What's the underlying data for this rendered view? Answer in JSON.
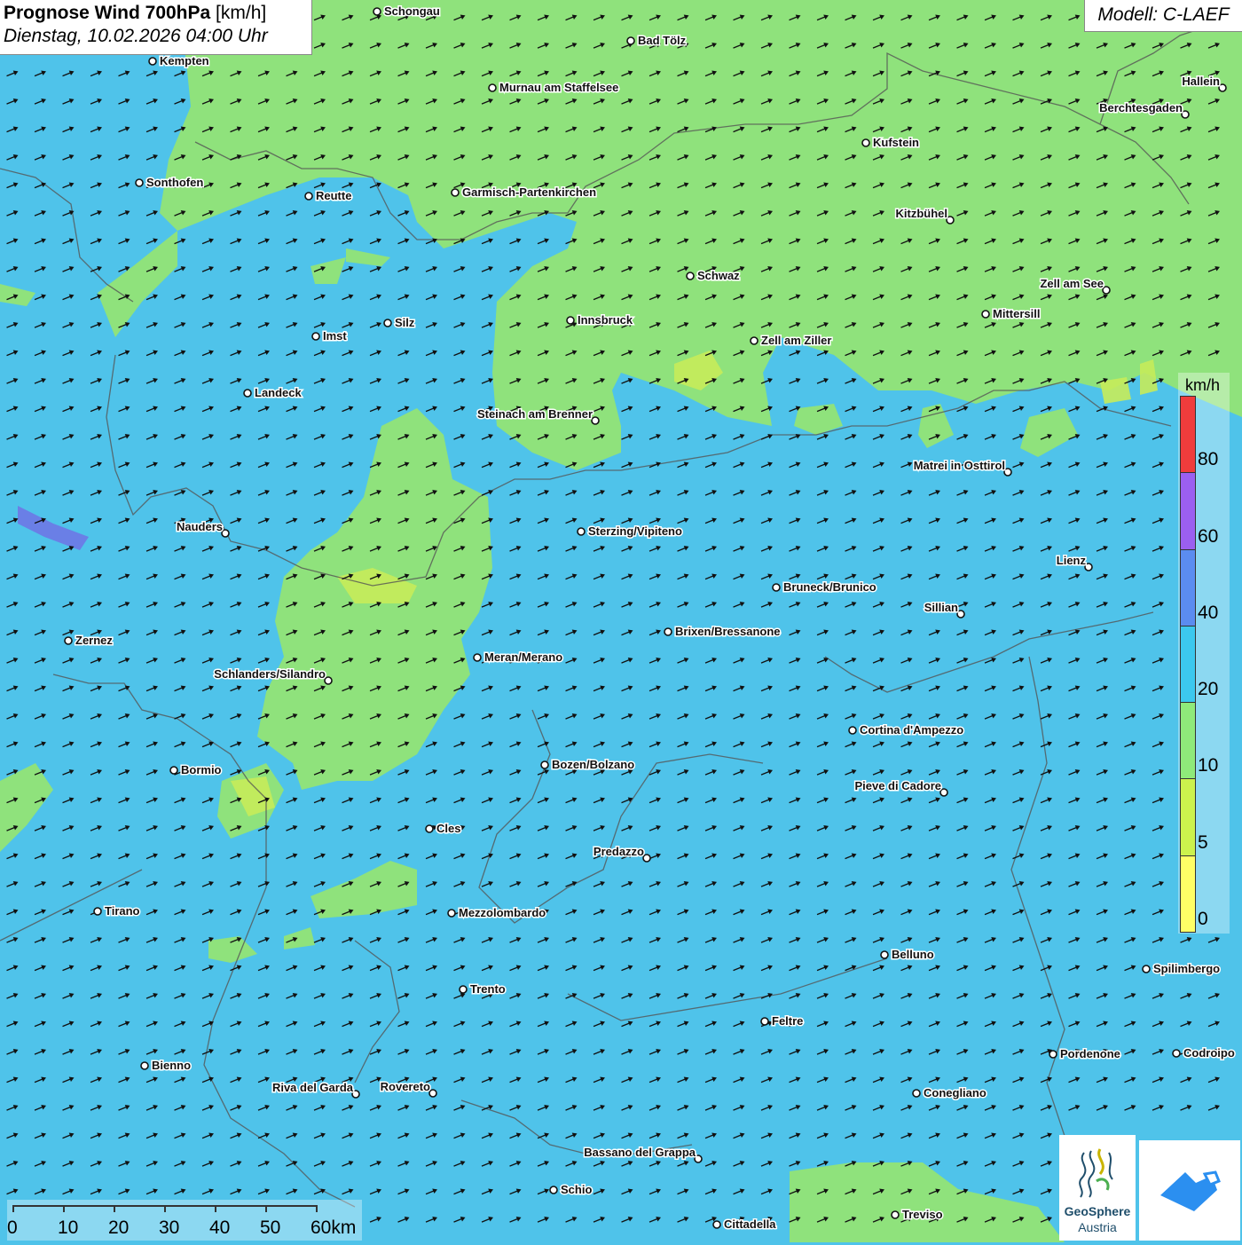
{
  "header": {
    "title_bold": "Prognose Wind 700hPa",
    "title_unit": "[km/h]",
    "date": "Dienstag, 10.02.2026 04:00 Uhr",
    "model": "Modell: C-LAEF"
  },
  "legend": {
    "unit": "km/h",
    "classes": [
      {
        "label": "0",
        "color": "#ffff66"
      },
      {
        "label": "5",
        "color": "#ccf24d"
      },
      {
        "label": "10",
        "color": "#8fea7a"
      },
      {
        "label": "20",
        "color": "#3cc8ee"
      },
      {
        "label": "40",
        "color": "#5b8cf0"
      },
      {
        "label": "60",
        "color": "#9b5ff0"
      },
      {
        "label": "80",
        "color": "#f03c3c"
      }
    ]
  },
  "scale": {
    "ticks": [
      "0",
      "10",
      "20",
      "30",
      "40",
      "50",
      "60km"
    ]
  },
  "logo": {
    "line1": "GeoSphere",
    "line2": "Austria"
  },
  "wind": {
    "direction": "from west-southwest",
    "arrow_icon": "wind-arrow-icon"
  },
  "cities": [
    "Schongau",
    "Bad Tölz",
    "Kempten",
    "Murnau am Staffelsee",
    "Hallein",
    "Berchtesgaden",
    "Kufstein",
    "Sonthofen",
    "Reutte",
    "Garmisch-Partenkirchen",
    "Kitzbühel",
    "Schwaz",
    "Zell am See",
    "Mittersill",
    "Innsbruck",
    "Imst",
    "Silz",
    "Zell am Ziller",
    "Landeck",
    "Steinach am Brenner",
    "Matrei in Osttirol",
    "Nauders",
    "Sterzing/Vipiteno",
    "Lienz",
    "Bruneck/Brunico",
    "Sillian",
    "Brixen/Bressanone",
    "Zernez",
    "Meran/Merano",
    "Schlanders/Silandro",
    "Cortina d'Ampezzo",
    "Bozen/Bolzano",
    "Bormio",
    "Pieve di Cadore",
    "Cles",
    "Predazzo",
    "Tirano",
    "Mezzolombardo",
    "Belluno",
    "Spilimbergo",
    "Trento",
    "Feltre",
    "Pordenone",
    "Codroipo",
    "Bienno",
    "Riva del Garda",
    "Rovereto",
    "Conegliano",
    "Bassano del Grappa",
    "Schio",
    "Treviso",
    "Cittadella"
  ]
}
